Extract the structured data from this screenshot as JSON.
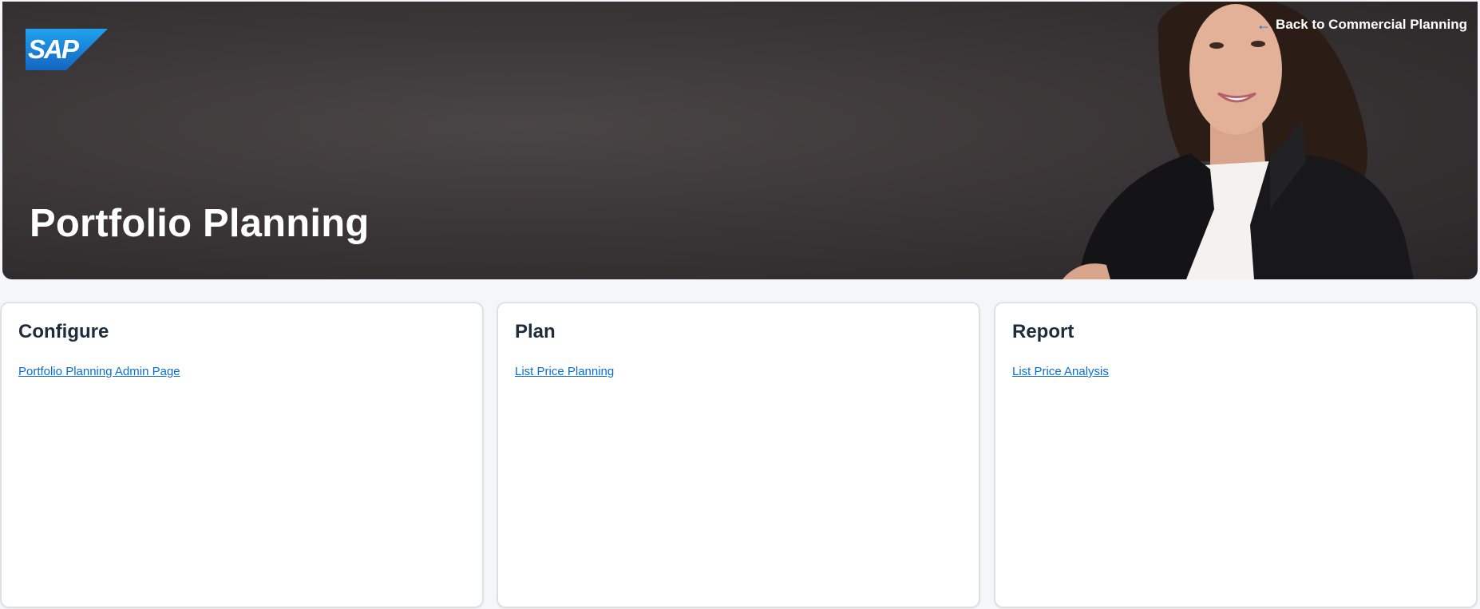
{
  "header": {
    "logo_text": "SAP",
    "back_link_label": "Back to Commercial Planning",
    "title": "Portfolio Planning",
    "back_arrow_icon": "arrow-left-icon"
  },
  "cards": [
    {
      "title": "Configure",
      "link": "Portfolio Planning Admin Page"
    },
    {
      "title": "Plan",
      "link": "List Price Planning"
    },
    {
      "title": "Report",
      "link": "List Price Analysis"
    }
  ],
  "colors": {
    "link": "#0a6ed1",
    "heading": "#1d2d3e",
    "hero_bg": "#3b3637",
    "logo_blue": "#1a7fd4"
  }
}
